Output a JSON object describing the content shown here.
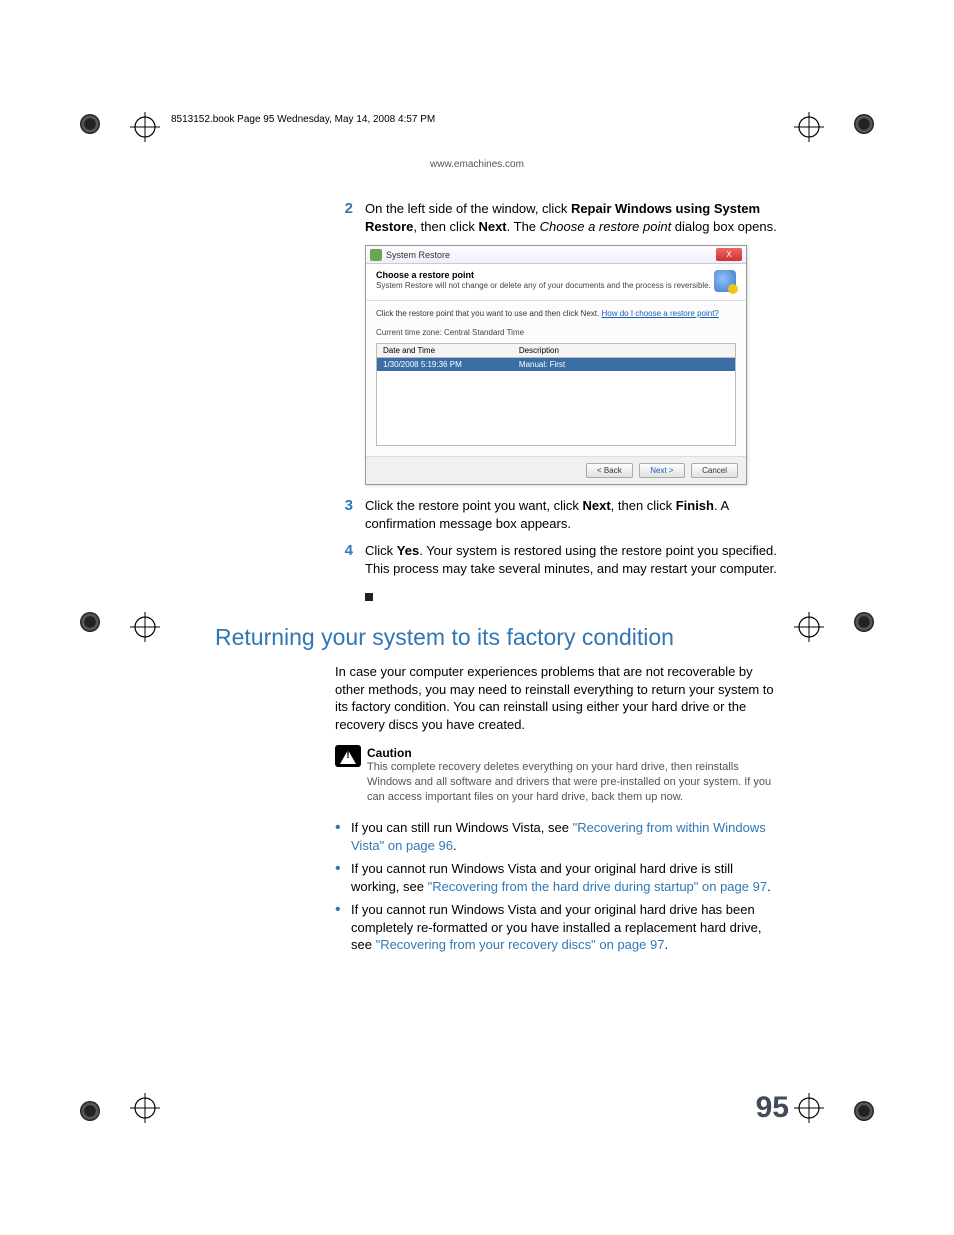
{
  "book_header": "8513152.book  Page 95  Wednesday, May 14, 2008  4:57 PM",
  "url": "www.emachines.com",
  "steps": {
    "s2": {
      "num": "2",
      "pre": "On the left side of the window, click ",
      "b1": "Repair Windows using System Restore",
      "mid": ", then click ",
      "b2": "Next",
      "post": ". The ",
      "i": "Choose a restore point",
      "tail": " dialog box opens."
    },
    "s3": {
      "num": "3",
      "pre": "Click the restore point you want, click ",
      "b1": "Next",
      "mid": ", then click ",
      "b2": "Finish",
      "post": ". A confirmation message box appears."
    },
    "s4": {
      "num": "4",
      "pre": "Click ",
      "b1": "Yes",
      "post": ". Your system is restored using the restore point you specified. This process may take several minutes, and may restart your computer."
    }
  },
  "dialog": {
    "title": "System Restore",
    "close": "X",
    "heading": "Choose a restore point",
    "subheading": "System Restore will not change or delete any of your documents and the process is reversible.",
    "instruction": "Click the restore point that you want to use and then click Next.",
    "help_link": "How do I choose a restore point?",
    "timezone": "Current time zone: Central Standard Time",
    "col_date": "Date and Time",
    "col_desc": "Description",
    "row_date": "1/30/2008 5:19:36 PM",
    "row_desc": "Manual: First",
    "btn_back": "< Back",
    "btn_next": "Next >",
    "btn_cancel": "Cancel"
  },
  "section_title": "Returning your system to its factory condition",
  "intro_para": "In case your computer experiences problems that are not recoverable by other methods, you may need to reinstall everything to return your system to its factory condition. You can reinstall using either your hard drive or the recovery discs you have created.",
  "caution": {
    "title": "Caution",
    "text": "This complete recovery deletes everything on your hard drive, then reinstalls Windows and all software and drivers that were pre-installed on your system. If you can access important files on your hard drive, back them up now."
  },
  "bullets": {
    "b1": {
      "pre": "If you can still run Windows Vista, see ",
      "link": "\"Recovering from within Windows Vista\" on page 96",
      "post": "."
    },
    "b2": {
      "pre": "If you cannot run Windows Vista and your original hard drive is still working, see ",
      "link": "\"Recovering from the hard drive during startup\" on page 97",
      "post": "."
    },
    "b3": {
      "pre": "If you cannot run Windows Vista and your original hard drive has been completely re-formatted or you have installed a replacement hard drive, see ",
      "link": "\"Recovering from your recovery discs\" on page 97",
      "post": "."
    }
  },
  "page_number": "95"
}
